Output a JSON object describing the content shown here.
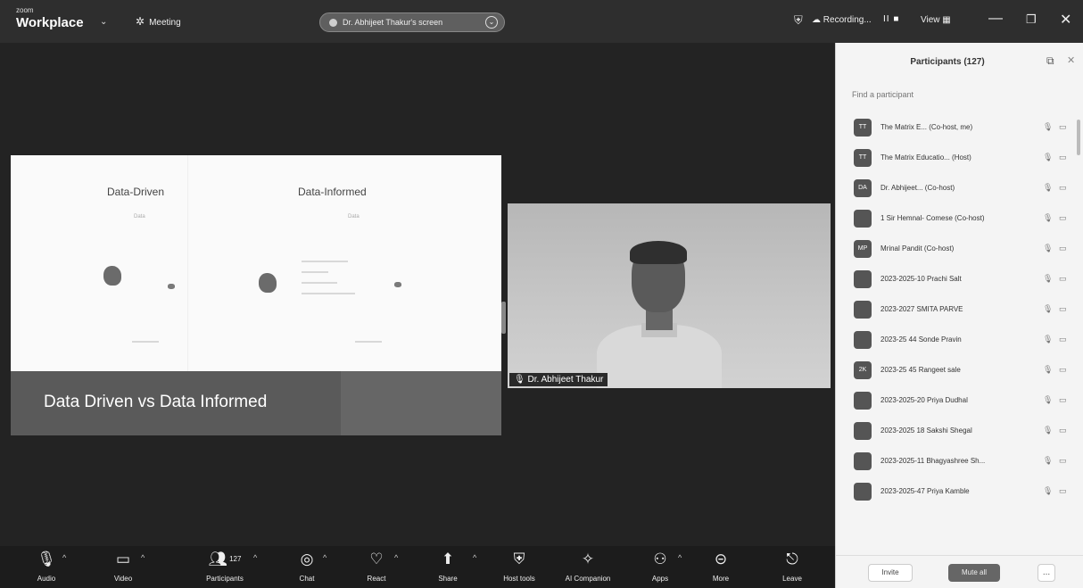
{
  "app": {
    "logo_small": "zoom",
    "logo_big": "Workplace",
    "meeting_label": "Meeting",
    "share_banner": "Dr. Abhijeet Thakur's screen",
    "recording_label": "Recording...",
    "recording_controls": "II ■",
    "view_label": "View"
  },
  "slide": {
    "left_title": "Data-Driven",
    "right_title": "Data-Informed",
    "left_label_data": "Data",
    "right_label_data": "Data",
    "caption": "Data Driven vs Data Informed"
  },
  "video": {
    "name_tag": "Dr. Abhijeet Thakur"
  },
  "toolbar": {
    "audio": "Audio",
    "video": "Video",
    "participants": "Participants",
    "participants_count": "127",
    "chat": "Chat",
    "react": "React",
    "share": "Share",
    "host_tools": "Host tools",
    "ai_companion": "AI Companion",
    "apps": "Apps",
    "more": "More",
    "leave": "Leave"
  },
  "panel": {
    "title": "Participants (127)",
    "search_placeholder": "Find a participant",
    "participants": [
      {
        "initials": "TT",
        "name": "The Matrix E...  (Co-host, me)"
      },
      {
        "initials": "TT",
        "name": "The Matrix Educatio... (Host)"
      },
      {
        "initials": "DA",
        "name": "Dr. Abhijeet...  (Co-host)"
      },
      {
        "initials": "",
        "name": "1 Sir Hemnal- Comese (Co-host)"
      },
      {
        "initials": "MP",
        "name": "Mrinal Pandit (Co-host)"
      },
      {
        "initials": "",
        "name": "2023-2025-10 Prachi Salt"
      },
      {
        "initials": "",
        "name": "2023-2027 SMITA PARVE"
      },
      {
        "initials": "",
        "name": "2023-25 44 Sonde Pravin"
      },
      {
        "initials": "2K",
        "name": "2023-25 45 Rangeet sale"
      },
      {
        "initials": "",
        "name": "2023-2025-20 Priya Dudhal"
      },
      {
        "initials": "",
        "name": "2023-2025 18 Sakshi Shegal"
      },
      {
        "initials": "",
        "name": "2023-2025-11 Bhagyashree Sh..."
      },
      {
        "initials": "",
        "name": "2023-2025-47 Priya Kamble"
      }
    ],
    "invite_label": "Invite",
    "mute_all_label": "Mute all",
    "more_label": "..."
  }
}
